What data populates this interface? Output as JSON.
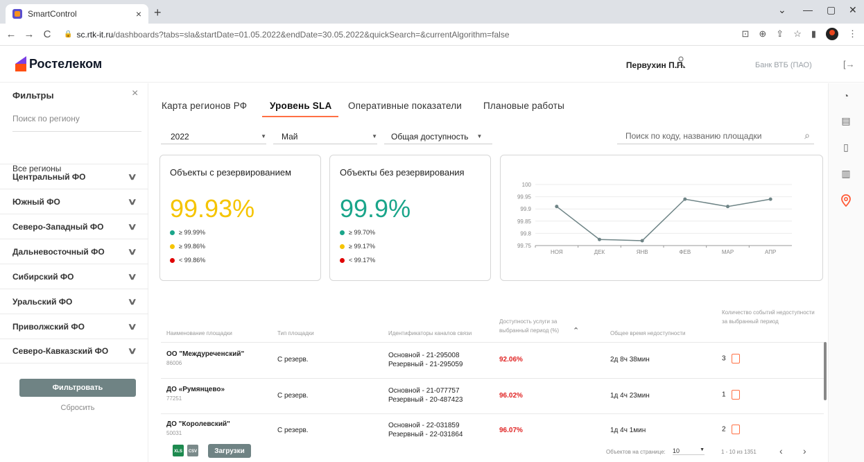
{
  "browser": {
    "tab_title": "SmartControl",
    "tab_close": "×",
    "new_tab": "+",
    "url_host": "sc.rtk-it.ru",
    "url_rest": "/dashboards?tabs=sla&startDate=01.05.2022&endDate=30.05.2022&quickSearch=&currentAlgorithm=false",
    "back": "←",
    "forward": "→",
    "reload": "C"
  },
  "header": {
    "logo_text": "Ростелеком",
    "user_name": "Первухин П.П.",
    "org": "Банк ВТБ (ПАО)"
  },
  "sidebar": {
    "title": "Фильтры",
    "close": "×",
    "search_placeholder": "Поиск по региону",
    "all_regions": "Все регионы",
    "regions": [
      "Центральный ФО",
      "Южный ФО",
      "Северо-Западный ФО",
      "Дальневосточный ФО",
      "Сибирский ФО",
      "Уральский ФО",
      "Приволжский ФО",
      "Северо-Кавказский ФО"
    ],
    "filter_button": "Фильтровать",
    "reset_button": "Сбросить"
  },
  "tabs": [
    "Карта регионов РФ",
    "Уровень SLA",
    "Оперативные показатели",
    "Плановые работы"
  ],
  "filters": {
    "year": "2022",
    "month": "Май",
    "metric": "Общая доступность",
    "search_placeholder": "Поиск по коду, названию площадки"
  },
  "cards": {
    "with_reserve": {
      "title": "Объекты с резервированием",
      "value": "99.93%",
      "value_color": "#f5c400",
      "legend": [
        "≥ 99.99%",
        "≥ 99.86%",
        "< 99.86%"
      ]
    },
    "without_reserve": {
      "title": "Объекты без резервирования",
      "value": "99.9%",
      "value_color": "#1aa58a",
      "legend": [
        "≥ 99.70%",
        "≥ 99.17%",
        "< 99.17%"
      ]
    },
    "legend_colors": [
      "#1aa58a",
      "#f5c400",
      "#e00000"
    ]
  },
  "chart_data": {
    "type": "line",
    "categories": [
      "НОЯ",
      "ДЕК",
      "ЯНВ",
      "ФЕВ",
      "МАР",
      "АПР"
    ],
    "series": [
      {
        "values": [
          99.91,
          99.775,
          99.77,
          99.94,
          99.91,
          99.94
        ]
      }
    ],
    "yticks": [
      "100",
      "99.95",
      "99.9",
      "99.85",
      "99.8",
      "99.75"
    ],
    "ylim": [
      99.75,
      100
    ],
    "color": "#6e8486"
  },
  "table": {
    "headers": {
      "name": "Наименование площадки",
      "type": "Тип площадки",
      "channels": "Идентификаторы каналов связи",
      "availability": "Доступность услуги за выбранный период (%)",
      "downtime": "Общее время недоступности",
      "events": "Количество событий недоступности за выбранный период"
    },
    "rows": [
      {
        "name": "ОО \"Междуреченский\"",
        "code": "86006",
        "type": "С резерв.",
        "ch1": "Основной - 21-295008",
        "ch2": "Резервный - 21-295059",
        "pct": "92.06%",
        "downtime": "2д 8ч 38мин",
        "events": "3"
      },
      {
        "name": "ДО «Румянцево»",
        "code": "77251",
        "type": "С резерв.",
        "ch1": "Основной - 21-077757",
        "ch2": "Резервный - 20-487423",
        "pct": "96.02%",
        "downtime": "1д 4ч 23мин",
        "events": "1"
      },
      {
        "name": "ДО \"Королевский\"",
        "code": "50031",
        "type": "С резерв.",
        "ch1": "Основной - 22-031859",
        "ch2": "Резервный - 22-031864",
        "pct": "96.07%",
        "downtime": "1д 4ч 1мин",
        "events": "2"
      }
    ]
  },
  "footer": {
    "xls": "XLS",
    "csv": "CSV",
    "downloads": "Загрузки",
    "per_page_label": "Объектов на странице:",
    "per_page": "10",
    "range": "1 - 10 из 1351",
    "prev": "‹",
    "next": "›"
  }
}
